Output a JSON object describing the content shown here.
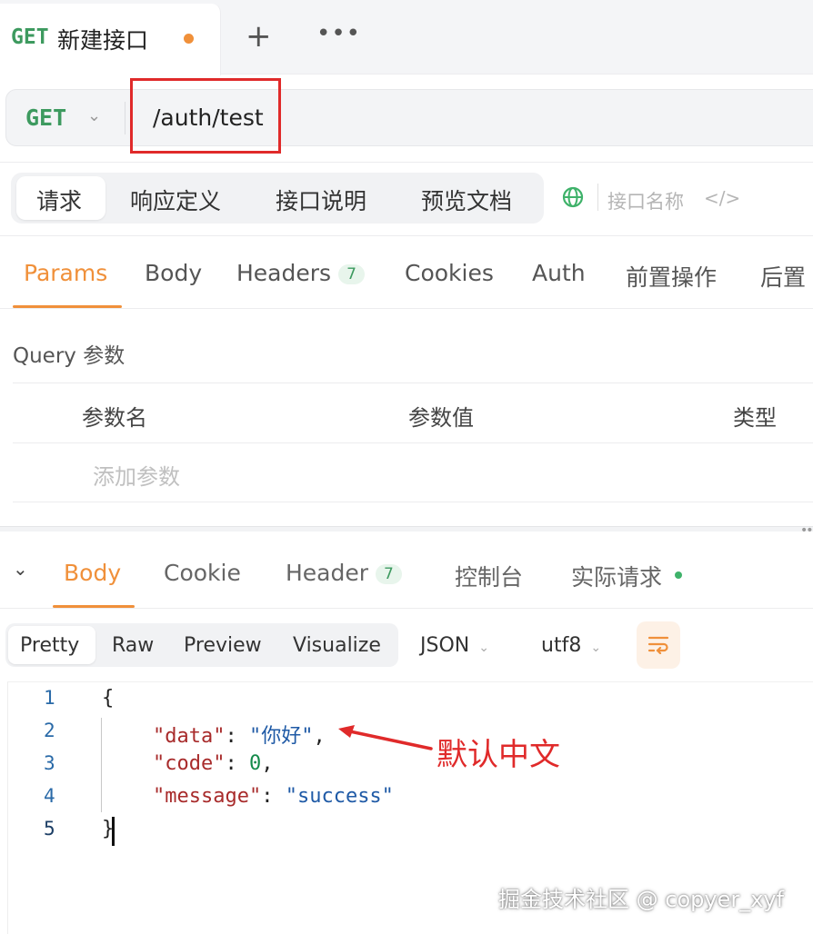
{
  "tab": {
    "method": "GET",
    "title": "新建接口",
    "add": "+",
    "more": "•••"
  },
  "url": {
    "method": "GET",
    "path": "/auth/test"
  },
  "modes": [
    {
      "label": "请求"
    },
    {
      "label": "响应定义"
    },
    {
      "label": "接口说明"
    },
    {
      "label": "预览文档"
    }
  ],
  "name_placeholder": "接口名称",
  "code_icon": "</>",
  "request_tabs": {
    "params": "Params",
    "body": "Body",
    "headers": "Headers",
    "headers_count": "7",
    "cookies": "Cookies",
    "auth": "Auth",
    "pre": "前置操作",
    "post": "后置"
  },
  "query": {
    "title": "Query 参数",
    "col_name": "参数名",
    "col_value": "参数值",
    "col_type": "类型",
    "add": "添加参数"
  },
  "response_tabs": {
    "body": "Body",
    "cookie": "Cookie",
    "header": "Header",
    "header_count": "7",
    "console": "控制台",
    "actual": "实际请求"
  },
  "formats": {
    "pretty": "Pretty",
    "raw": "Raw",
    "preview": "Preview",
    "visualize": "Visualize"
  },
  "lang": "JSON",
  "charset": "utf8",
  "code_lines": [
    {
      "n": "1",
      "text": "{"
    },
    {
      "n": "2",
      "key": "\"data\"",
      "sep": ": ",
      "val": "\"你好\"",
      "tail": ","
    },
    {
      "n": "3",
      "key": "\"code\"",
      "sep": ": ",
      "val": "0",
      "tail": ","
    },
    {
      "n": "4",
      "key": "\"message\"",
      "sep": ": ",
      "val": "\"success\"",
      "tail": ""
    },
    {
      "n": "5",
      "text": "}"
    }
  ],
  "annotation": "默认中文",
  "watermark": "掘金技术社区 @ copyer_xyf",
  "colors": {
    "accent": "#f0903a",
    "get": "#3d9a5f",
    "annotation": "#e02a2a"
  }
}
